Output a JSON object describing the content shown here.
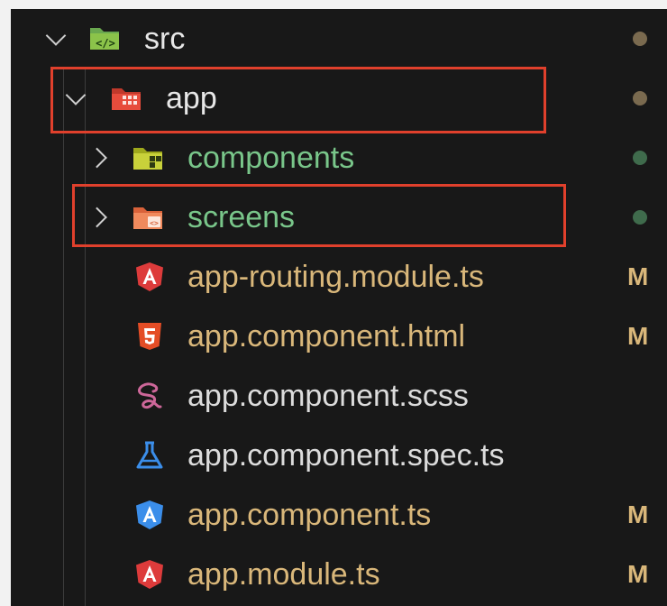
{
  "tree": {
    "src": {
      "label": "src",
      "icon": "folder-src-icon",
      "expanded": true,
      "status_color": "#7a6a4f"
    },
    "app": {
      "label": "app",
      "icon": "folder-app-icon",
      "expanded": true,
      "status_color": "#7a6a4f"
    },
    "components": {
      "label": "components",
      "icon": "folder-components-icon",
      "expanded": false,
      "status_color": "#3f6b4c"
    },
    "screens": {
      "label": "screens",
      "icon": "folder-screens-icon",
      "expanded": false,
      "status_color": "#3f6b4c"
    },
    "files": [
      {
        "label": "app-routing.module.ts",
        "icon": "angular-routing-icon",
        "status": "M"
      },
      {
        "label": "app.component.html",
        "icon": "html5-icon",
        "status": "M"
      },
      {
        "label": "app.component.scss",
        "icon": "sass-icon",
        "status": ""
      },
      {
        "label": "app.component.spec.ts",
        "icon": "test-flask-icon",
        "status": ""
      },
      {
        "label": "app.component.ts",
        "icon": "angular-component-icon",
        "status": "M"
      },
      {
        "label": "app.module.ts",
        "icon": "angular-module-icon",
        "status": "M"
      }
    ]
  },
  "colors": {
    "folder_label": "#e7e7e7",
    "untracked_label": "#79c68a",
    "modified_label": "#d9b77a",
    "plain_label": "#dcdcdc",
    "modified_badge": "#d9b77a",
    "highlight": "#e0402c"
  }
}
